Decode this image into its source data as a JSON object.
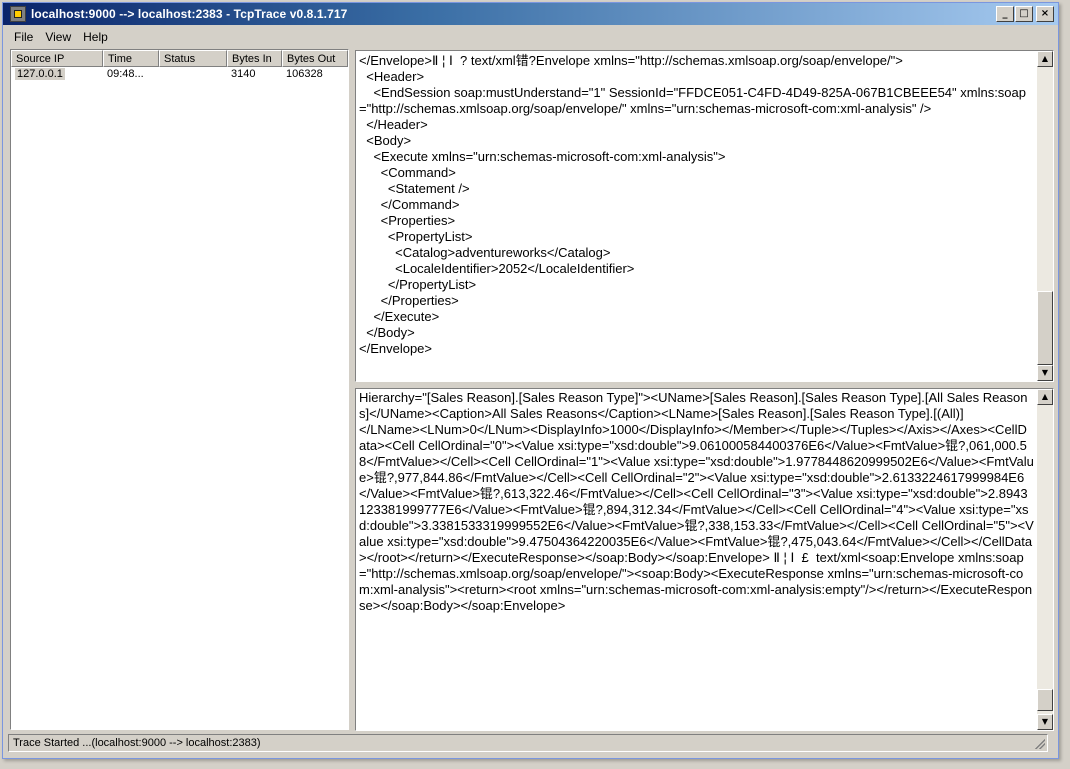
{
  "window": {
    "title": "localhost:9000 --> localhost:2383 - TcpTrace v0.8.1.717",
    "controls": {
      "minimize": "_",
      "maximize": "□",
      "close": "×"
    }
  },
  "menu": [
    "File",
    "View",
    "Help"
  ],
  "connections": {
    "columns": [
      "Source IP",
      "Time",
      "Status",
      "Bytes In",
      "Bytes Out"
    ],
    "rows": [
      {
        "source_ip": "127.0.0.1",
        "time": "09:48...",
        "status": "",
        "bytes_in": "3140",
        "bytes_out": "106328"
      }
    ]
  },
  "request_pane": {
    "lines": [
      "</Envelope>Ⅱ ¦ Ⅰ  ? text/xml错?Envelope xmlns=\"http://schemas.xmlsoap.org/soap/envelope/\">",
      "  <Header>",
      "    <EndSession soap:mustUnderstand=\"1\" SessionId=\"FFDCE051-C4FD-4D49-825A-067B1CBEEE54\" xmlns:soap=\"http://schemas.xmlsoap.org/soap/envelope/\" xmlns=\"urn:schemas-microsoft-com:xml-analysis\" />",
      "  </Header>",
      "  <Body>",
      "    <Execute xmlns=\"urn:schemas-microsoft-com:xml-analysis\">",
      "      <Command>",
      "        <Statement />",
      "      </Command>",
      "      <Properties>",
      "        <PropertyList>",
      "          <Catalog>adventureworks</Catalog>",
      "          <LocaleIdentifier>2052</LocaleIdentifier>",
      "        </PropertyList>",
      "      </Properties>",
      "    </Execute>",
      "  </Body>",
      "</Envelope>"
    ]
  },
  "response_pane": {
    "lines": [
      "Hierarchy=\"[Sales Reason].[Sales Reason Type]\"><UName>[Sales Reason].[Sales Reason Type].[All Sales Reasons]</UName><Caption>All Sales Reasons</Caption><LName>[Sales Reason].[Sales Reason Type].[(All)]",
      "</LName><LNum>0</LNum><DisplayInfo>1000</DisplayInfo></Member></Tuple></Tuples></Axis></Axes><CellData><Cell CellOrdinal=\"0\"><Value xsi:type=\"xsd:double\">9.061000584400376E6</Value><FmtValue>锟?,061,000.58</FmtValue></Cell><Cell CellOrdinal=\"1\"><Value xsi:type=\"xsd:double\">1.9778448620999502E6</Value><FmtValue>锟?,977,844.86</FmtValue></Cell><Cell CellOrdinal=\"2\"><Value xsi:type=\"xsd:double\">2.6133224617999984E6</Value><FmtValue>锟?,613,322.46</FmtValue></Cell><Cell CellOrdinal=\"3\"><Value xsi:type=\"xsd:double\">2.8943123381999777E6</Value><FmtValue>锟?,894,312.34</FmtValue></Cell><Cell CellOrdinal=\"4\"><Value xsi:type=\"xsd:double\">3.3381533319999552E6</Value><FmtValue>锟?,338,153.33</FmtValue></Cell><Cell CellOrdinal=\"5\"><Value xsi:type=\"xsd:double\">9.47504364220035E6</Value><FmtValue>锟?,475,043.64</FmtValue></Cell></CellData></root></return></ExecuteResponse></soap:Body></soap:Envelope> Ⅱ ¦ Ⅰ  £  text/xml<soap:Envelope xmlns:soap=\"http://schemas.xmlsoap.org/soap/envelope/\"><soap:Body><ExecuteResponse xmlns=\"urn:schemas-microsoft-com:xml-analysis\"><return><root xmlns=\"urn:schemas-microsoft-com:xml-analysis:empty\"/></return></ExecuteResponse></soap:Body></soap:Envelope>"
    ]
  },
  "statusbar": {
    "text": "Trace Started ...(localhost:9000 --> localhost:2383)"
  },
  "icons": {
    "app": "tcptrace-app-icon",
    "scroll_up": "▲",
    "scroll_down": "▼"
  }
}
